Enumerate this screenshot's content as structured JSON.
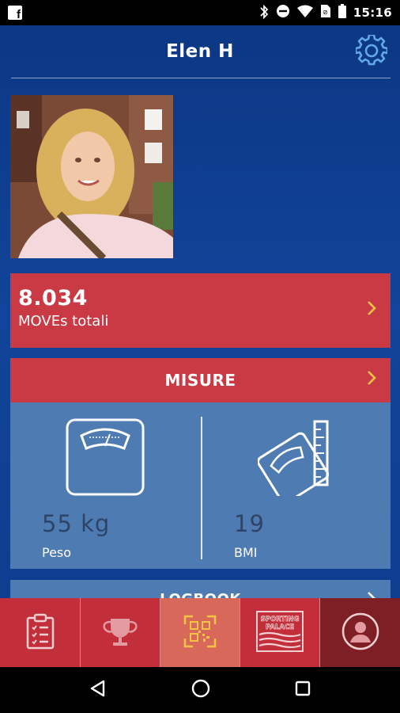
{
  "status_bar": {
    "time": "15:16",
    "icons": [
      "facebook-icon",
      "bluetooth-icon",
      "do-not-disturb-icon",
      "wifi-icon",
      "no-sim-icon",
      "battery-icon"
    ]
  },
  "header": {
    "title": "Elen H",
    "settings_icon": "gear-icon"
  },
  "moves": {
    "value": "8.034",
    "label": "MOVEs totali"
  },
  "misure": {
    "title": "MISURE",
    "weight": {
      "value": "55 kg",
      "label": "Peso",
      "icon": "scale-icon"
    },
    "bmi": {
      "value": "19",
      "label": "BMI",
      "icon": "scale-ruler-icon"
    }
  },
  "logbook": {
    "title": "LOGBOOK"
  },
  "tabs": [
    {
      "name": "clipboard-icon"
    },
    {
      "name": "trophy-icon"
    },
    {
      "name": "qr-code-icon"
    },
    {
      "name": "sporting-palace-logo",
      "logo_text": [
        "SPORTING",
        "PALACE"
      ]
    },
    {
      "name": "profile-icon"
    }
  ],
  "colors": {
    "background": "#0d3a86",
    "accent_red": "#c93a45",
    "card_blue": "#4f7bb3",
    "chevron": "#f6c445",
    "active_tab": "#d8695a",
    "profile_tab": "#7e1f26"
  }
}
